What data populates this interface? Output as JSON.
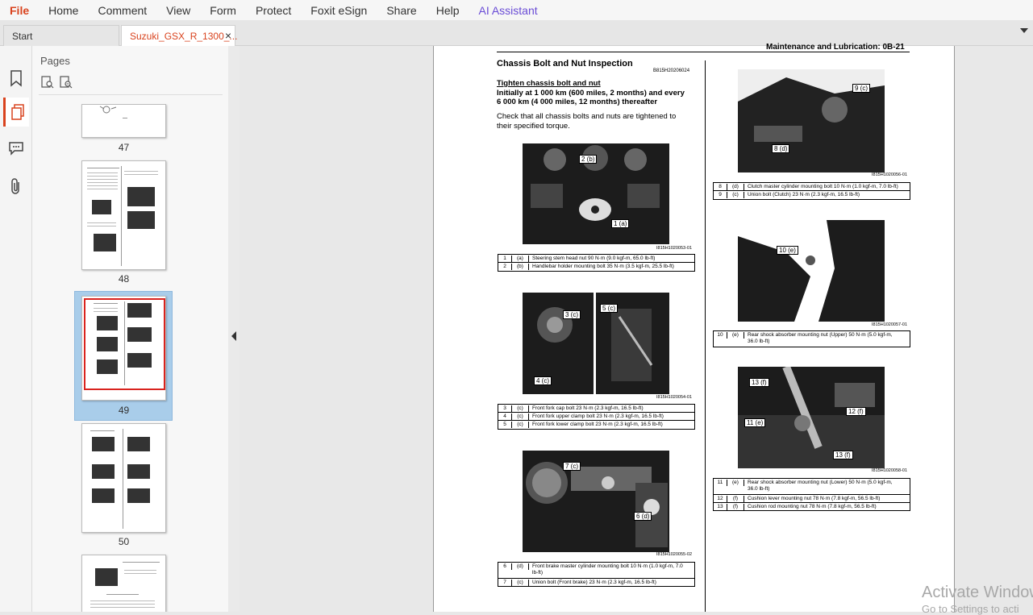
{
  "menu": {
    "items": [
      "File",
      "Home",
      "Comment",
      "View",
      "Form",
      "Protect",
      "Foxit eSign",
      "Share",
      "Help",
      "AI Assistant"
    ]
  },
  "tabs": {
    "start": "Start",
    "document": "Suzuki_GSX_R_1300_...",
    "close": "×"
  },
  "sidebar": {
    "title": "Pages",
    "icons": [
      "bookmark-icon",
      "pages-icon",
      "comment-icon",
      "attachment-icon"
    ]
  },
  "thumbnails": [
    {
      "label": "47"
    },
    {
      "label": "48"
    },
    {
      "label": "49",
      "selected": true
    },
    {
      "label": "50"
    }
  ],
  "document": {
    "header": "Maintenance and Lubrication:   0B-21",
    "section_title": "Chassis Bolt and Nut Inspection",
    "section_code": "B815H20206024",
    "subtitle": "Tighten chassis bolt and nut",
    "interval_line1": "Initially at 1 000 km (600 miles, 2 months) and every",
    "interval_line2": "6 000 km (4 000 miles, 12 months) thereafter",
    "body_line1": "Check that all chassis bolts and nuts are tightened to",
    "body_line2": "their specified torque.",
    "figures": [
      {
        "caption": "I815H1020053-01",
        "rows": [
          {
            "n": "1",
            "icon": "(a)",
            "text": "Steering stem head nut 90 N·m (9.0 kgf-m, 65.0 lb-ft)"
          },
          {
            "n": "2",
            "icon": "(b)",
            "text": "Handlebar holder mounting bolt 35 N·m (3.5 kgf-m, 25.5 lb-ft)"
          }
        ]
      },
      {
        "caption": "I815H1020054-01",
        "rows": [
          {
            "n": "3",
            "icon": "(c)",
            "text": "Front fork cap bolt 23 N·m (2.3 kgf-m, 16.5 lb-ft)"
          },
          {
            "n": "4",
            "icon": "(c)",
            "text": "Front fork upper clamp bolt 23 N·m (2.3 kgf-m, 16.5 lb-ft)"
          },
          {
            "n": "5",
            "icon": "(c)",
            "text": "Front fork lower clamp bolt 23 N·m (2.3 kgf-m, 16.5 lb-ft)"
          }
        ]
      },
      {
        "caption": "I815H1020055-02",
        "rows": [
          {
            "n": "6",
            "icon": "(d)",
            "text": "Front brake master cylinder mounting bolt 10 N·m (1.0 kgf-m, 7.0"
          },
          {
            "n": "7",
            "icon": "(c)",
            "text": "Union bolt (Front brake) 23 N·m (2.3 kgf-m, 16.5 lb-ft)"
          }
        ],
        "row6_cont": "lb-ft)"
      },
      {
        "caption": "I815H1020056-01",
        "rows": [
          {
            "n": "8",
            "icon": "(d)",
            "text": "Clutch master cylinder mounting bolt 10 N·m (1.0 kgf-m, 7.0 lb-ft)"
          },
          {
            "n": "9",
            "icon": "(c)",
            "text": "Union bolt (Clutch) 23 N·m (2.3 kgf-m, 16.5 lb-ft)"
          }
        ]
      },
      {
        "caption": "I815H1020057-01",
        "rows": [
          {
            "n": "10",
            "icon": "(e)",
            "text": "Rear shock absorber mounting nut (Upper) 50 N·m (5.0 kgf-m,"
          }
        ],
        "row10_cont": "36.0 lb-ft)"
      },
      {
        "caption": "I815H1020058-01",
        "rows": [
          {
            "n": "11",
            "icon": "(e)",
            "text": "Rear shock absorber mounting nut (Lower) 50 N·m (5.0 kgf-m,"
          },
          {
            "n": "12",
            "icon": "(f)",
            "text": "Cushion lever mounting nut 78 N·m (7.8 kgf-m, 56.5 lb-ft)"
          },
          {
            "n": "13",
            "icon": "(f)",
            "text": "Cushion rod mounting nut 78 N·m (7.8 kgf-m, 56.5 lb-ft)"
          }
        ],
        "row11_cont": "36.0 lb-ft)"
      }
    ],
    "callouts": [
      "2 (b)",
      "1 (a)",
      "3 (c)",
      "5 (c)",
      "4 (c)",
      "7 (c)",
      "6 (d)",
      "9 (c)",
      "8 (d)",
      "10 (e)",
      "13 (f)",
      "12 (f)",
      "11 (e)",
      "13 (f)"
    ]
  },
  "watermark": {
    "line1": "Activate Window",
    "line2": "Go to Settings to acti"
  },
  "colors": {
    "accent": "#d9431e",
    "ai": "#6a4cd6",
    "selection": "#a9cdea"
  }
}
